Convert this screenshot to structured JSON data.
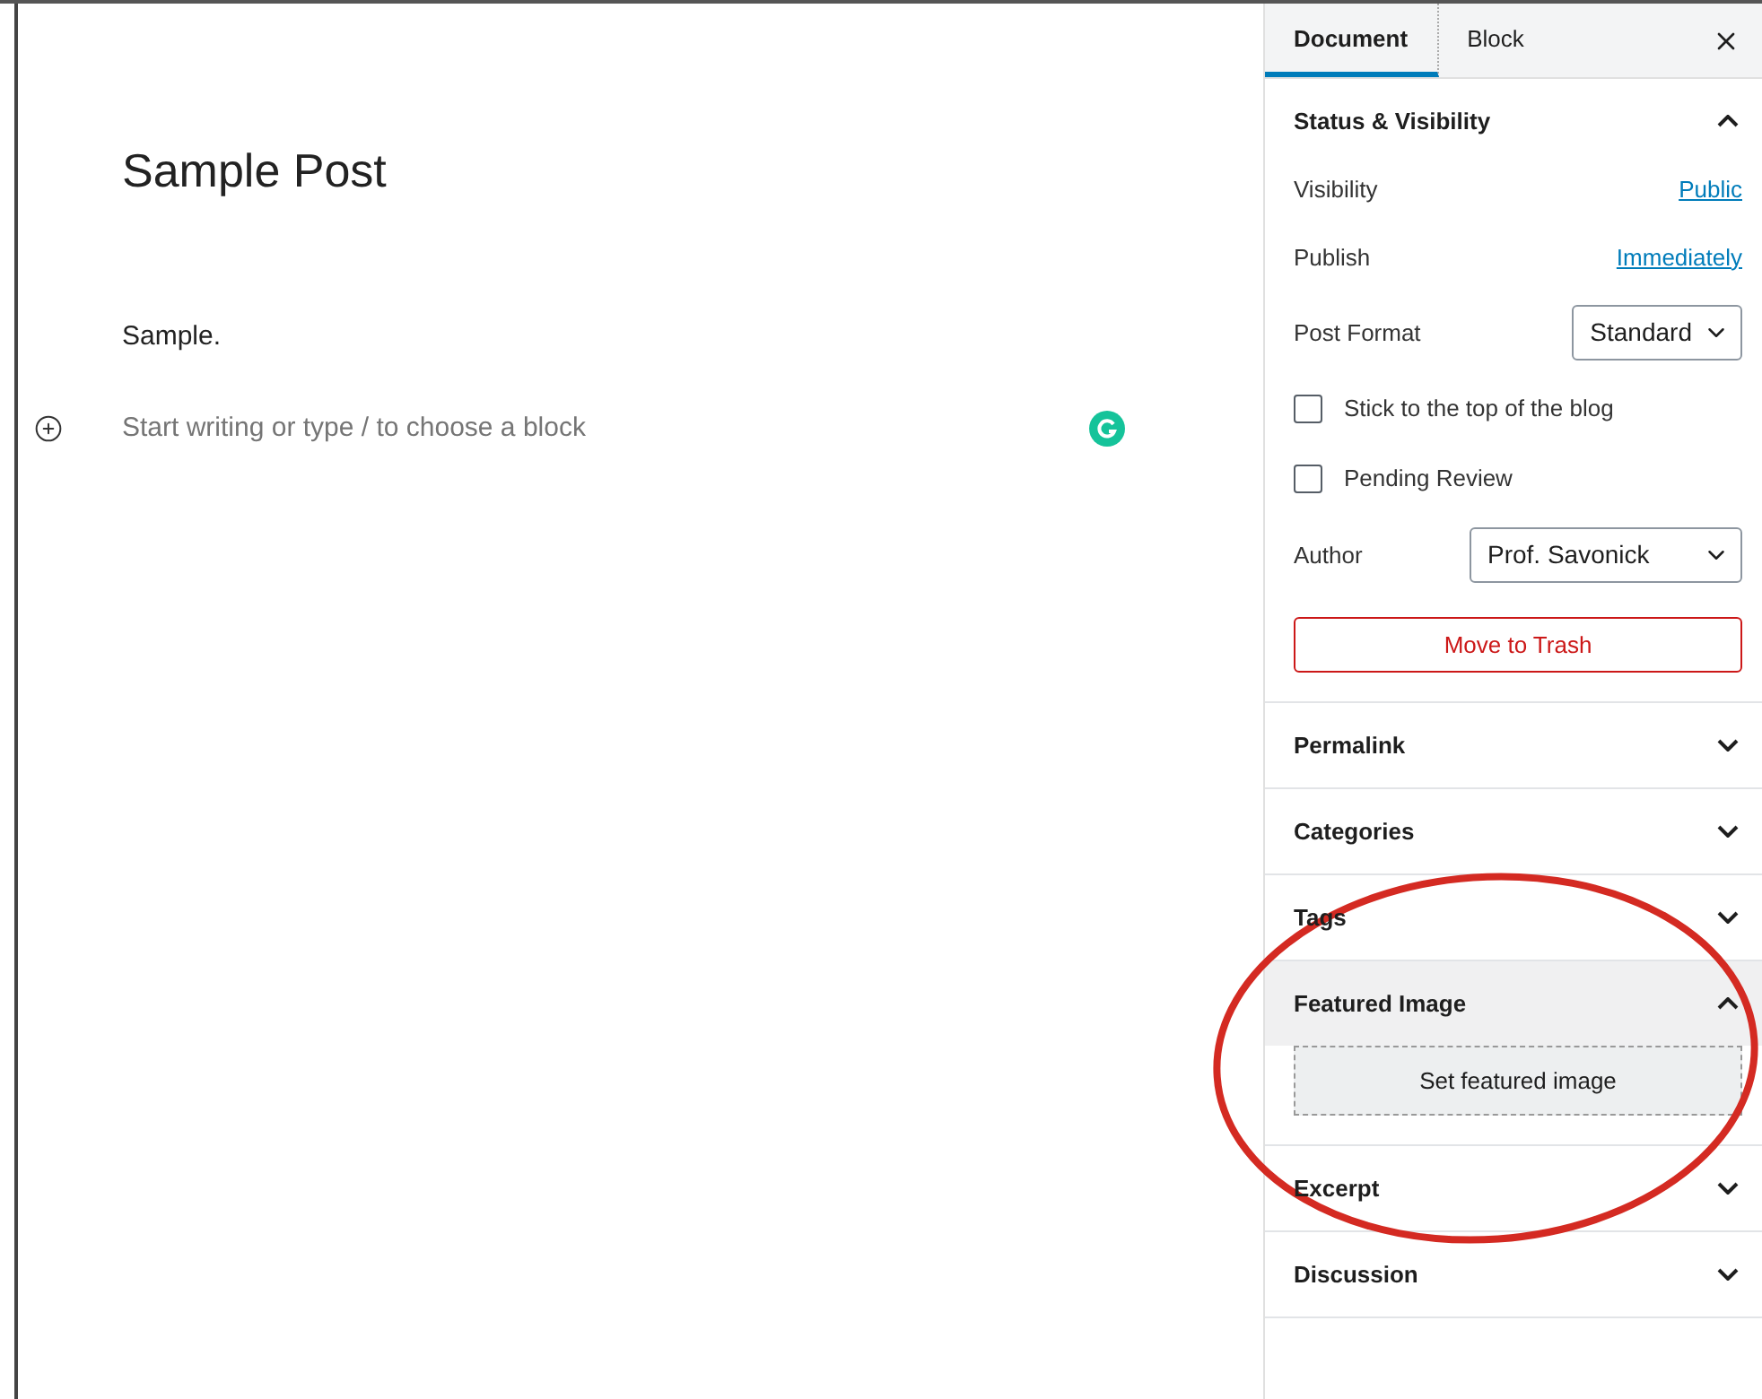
{
  "editor": {
    "title": "Sample Post",
    "paragraph": "Sample.",
    "placeholder": "Start writing or type / to choose a block"
  },
  "sidebar": {
    "tabs": [
      {
        "label": "Document",
        "selected": true
      },
      {
        "label": "Block",
        "selected": false
      }
    ],
    "panels": [
      {
        "title": "Status & Visibility",
        "expanded": true,
        "hovered": false,
        "rows": [
          {
            "kind": "link",
            "label": "Visibility",
            "value": "Public"
          },
          {
            "kind": "link",
            "label": "Publish",
            "value": "Immediately"
          },
          {
            "kind": "select",
            "label": "Post Format",
            "value": "Standard"
          },
          {
            "kind": "checkbox",
            "label": "Stick to the top of the blog",
            "checked": false
          },
          {
            "kind": "checkbox",
            "label": "Pending Review",
            "checked": false
          },
          {
            "kind": "select",
            "label": "Author",
            "value": "Prof. Savonick",
            "wide": true
          },
          {
            "kind": "danger",
            "label": "Move to Trash"
          }
        ]
      },
      {
        "title": "Permalink",
        "expanded": false,
        "hovered": false
      },
      {
        "title": "Categories",
        "expanded": false,
        "hovered": false
      },
      {
        "title": "Tags",
        "expanded": false,
        "hovered": false
      },
      {
        "title": "Featured Image",
        "expanded": true,
        "hovered": true,
        "rows": [
          {
            "kind": "dashed",
            "label": "Set featured image"
          }
        ]
      },
      {
        "title": "Excerpt",
        "expanded": false,
        "hovered": false
      },
      {
        "title": "Discussion",
        "expanded": false,
        "hovered": false
      }
    ]
  },
  "annotation": {
    "kind": "ellipse",
    "color": "#d42a22"
  }
}
